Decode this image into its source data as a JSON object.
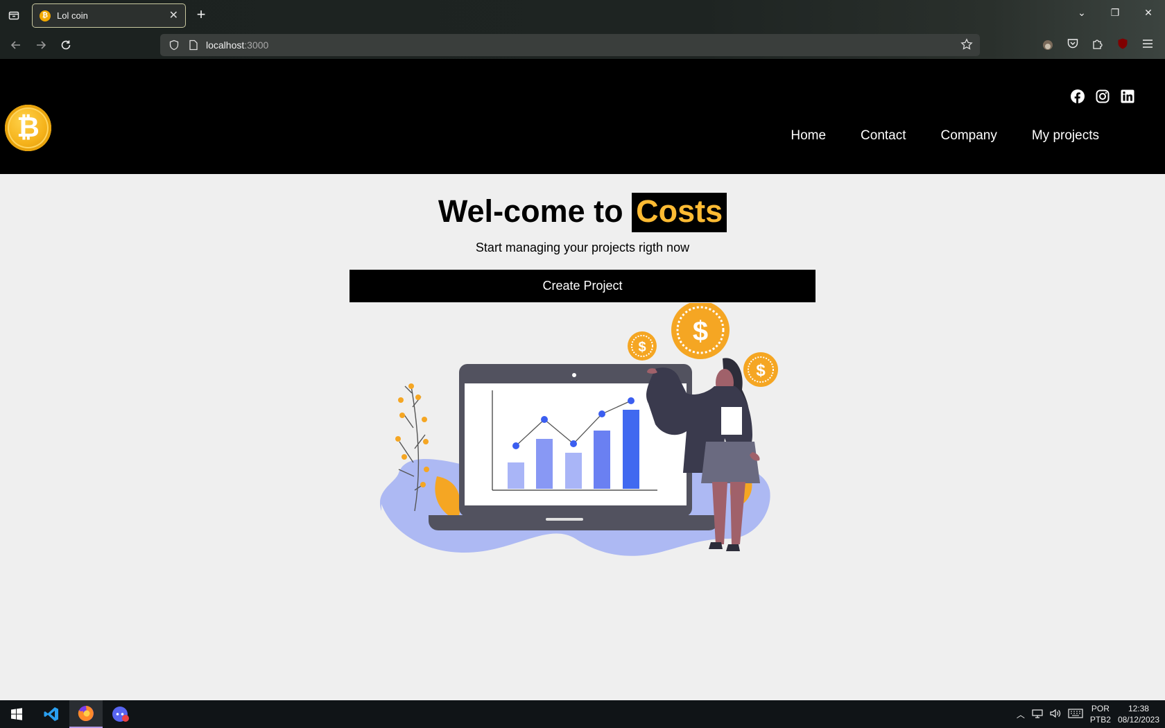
{
  "browser": {
    "tab": {
      "title": "Lol coin",
      "favicon": "bitcoin-icon"
    },
    "url": {
      "host": "localhost",
      "port": ":3000"
    }
  },
  "site": {
    "logo_icon": "bitcoin-logo",
    "social": [
      "facebook-icon",
      "instagram-icon",
      "linkedin-icon"
    ],
    "nav": {
      "home": "Home",
      "contact": "Contact",
      "company": "Company",
      "projects": "My projects"
    }
  },
  "hero": {
    "title_prefix": "Wel-come to ",
    "title_accent": "Costs",
    "subtitle": "Start managing your projects rigth now",
    "cta_label": "Create Project"
  },
  "taskbar": {
    "apps": [
      "windows-start-icon",
      "vscode-icon",
      "firefox-icon",
      "discord-icon"
    ],
    "lang_top": "POR",
    "lang_bottom": "PTB2",
    "time": "12:38",
    "date": "08/12/2023"
  },
  "colors": {
    "accent": "#ffbb33",
    "header_bg": "#000000",
    "page_bg": "#efefef"
  }
}
